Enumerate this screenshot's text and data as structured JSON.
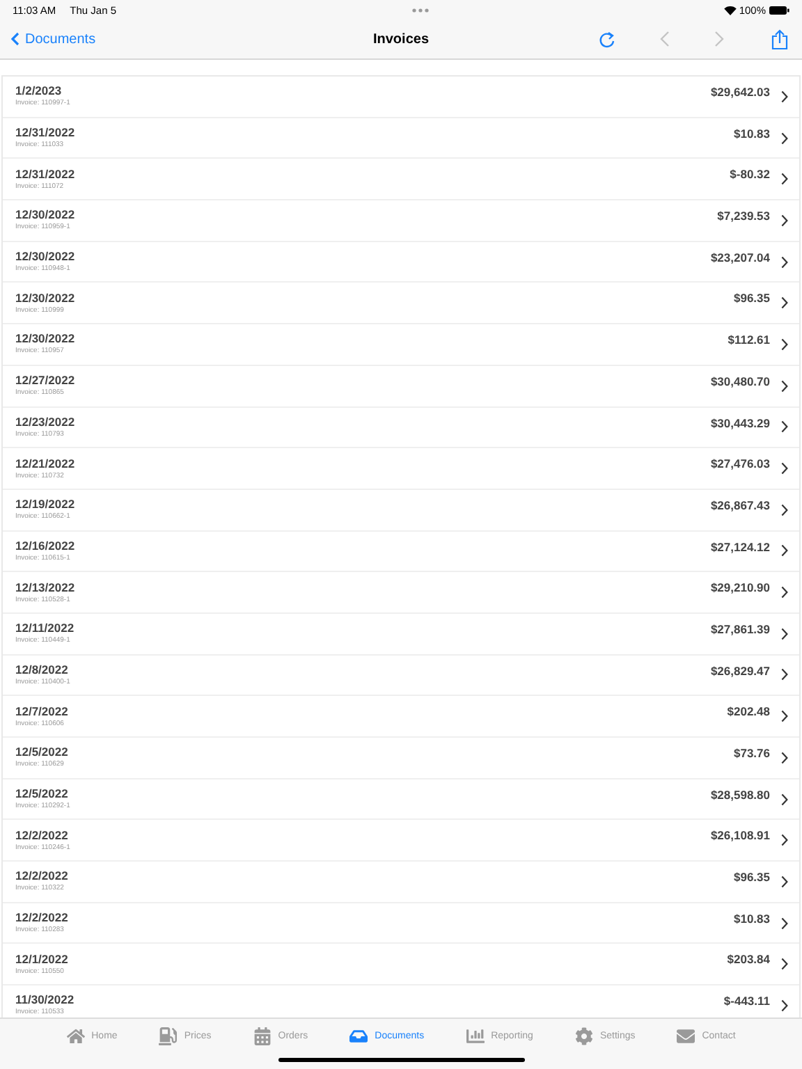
{
  "status_bar": {
    "time": "11:03 AM",
    "date": "Thu Jan 5",
    "battery": "100%"
  },
  "nav_bar": {
    "back": "Documents",
    "title": "Invoices",
    "prev_disabled": true,
    "next_disabled": true
  },
  "invoices": [
    {
      "date": "1/2/2023",
      "invoice": "Invoice: 110997-1",
      "amount": "$29,642.03"
    },
    {
      "date": "12/31/2022",
      "invoice": "Invoice: 111033",
      "amount": "$10.83"
    },
    {
      "date": "12/31/2022",
      "invoice": "Invoice: 111072",
      "amount": "$-80.32"
    },
    {
      "date": "12/30/2022",
      "invoice": "Invoice: 110959-1",
      "amount": "$7,239.53"
    },
    {
      "date": "12/30/2022",
      "invoice": "Invoice: 110948-1",
      "amount": "$23,207.04"
    },
    {
      "date": "12/30/2022",
      "invoice": "Invoice: 110999",
      "amount": "$96.35"
    },
    {
      "date": "12/30/2022",
      "invoice": "Invoice: 110957",
      "amount": "$112.61"
    },
    {
      "date": "12/27/2022",
      "invoice": "Invoice: 110865",
      "amount": "$30,480.70"
    },
    {
      "date": "12/23/2022",
      "invoice": "Invoice: 110793",
      "amount": "$30,443.29"
    },
    {
      "date": "12/21/2022",
      "invoice": "Invoice: 110732",
      "amount": "$27,476.03"
    },
    {
      "date": "12/19/2022",
      "invoice": "Invoice: 110662-1",
      "amount": "$26,867.43"
    },
    {
      "date": "12/16/2022",
      "invoice": "Invoice: 110615-1",
      "amount": "$27,124.12"
    },
    {
      "date": "12/13/2022",
      "invoice": "Invoice: 110528-1",
      "amount": "$29,210.90"
    },
    {
      "date": "12/11/2022",
      "invoice": "Invoice: 110449-1",
      "amount": "$27,861.39"
    },
    {
      "date": "12/8/2022",
      "invoice": "Invoice: 110400-1",
      "amount": "$26,829.47"
    },
    {
      "date": "12/7/2022",
      "invoice": "Invoice: 110606",
      "amount": "$202.48"
    },
    {
      "date": "12/5/2022",
      "invoice": "Invoice: 110629",
      "amount": "$73.76"
    },
    {
      "date": "12/5/2022",
      "invoice": "Invoice: 110292-1",
      "amount": "$28,598.80"
    },
    {
      "date": "12/2/2022",
      "invoice": "Invoice: 110246-1",
      "amount": "$26,108.91"
    },
    {
      "date": "12/2/2022",
      "invoice": "Invoice: 110322",
      "amount": "$96.35"
    },
    {
      "date": "12/2/2022",
      "invoice": "Invoice: 110283",
      "amount": "$10.83"
    },
    {
      "date": "12/1/2022",
      "invoice": "Invoice: 110550",
      "amount": "$203.84"
    },
    {
      "date": "11/30/2022",
      "invoice": "Invoice: 110533",
      "amount": "$-443.11"
    }
  ],
  "tab_bar": [
    {
      "label": "Home",
      "kind": "home",
      "selected": false
    },
    {
      "label": "Prices",
      "kind": "pump",
      "selected": false
    },
    {
      "label": "Orders",
      "kind": "calendar",
      "selected": false
    },
    {
      "label": "Documents",
      "kind": "inbox",
      "selected": true
    },
    {
      "label": "Reporting",
      "kind": "chart",
      "selected": false
    },
    {
      "label": "Settings",
      "kind": "gear",
      "selected": false
    },
    {
      "label": "Contact",
      "kind": "mail",
      "selected": false
    }
  ]
}
